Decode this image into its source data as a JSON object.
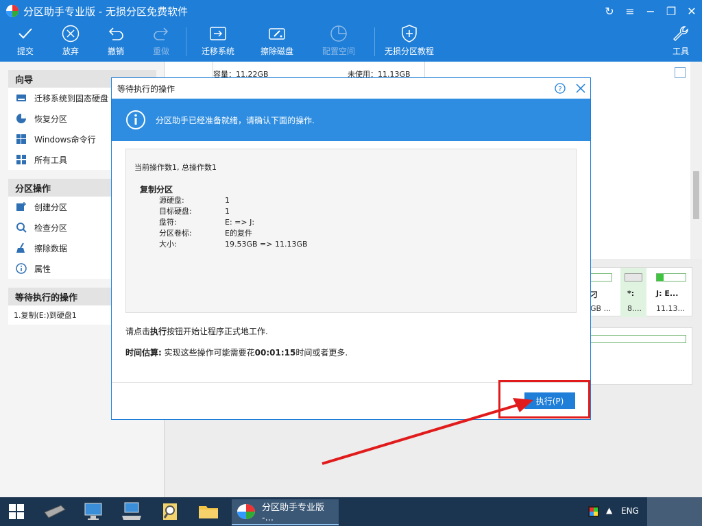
{
  "window": {
    "title": "分区助手专业版 - 无损分区免费软件"
  },
  "toolbar": {
    "items": [
      {
        "label": "提交",
        "icon": "check-icon",
        "enabled": true
      },
      {
        "label": "放弃",
        "icon": "cancel-circle-icon",
        "enabled": true
      },
      {
        "label": "撤销",
        "icon": "undo-icon",
        "enabled": true
      },
      {
        "label": "重做",
        "icon": "redo-icon",
        "enabled": false
      },
      {
        "label": "迁移系统",
        "icon": "migrate-disk-icon",
        "enabled": true
      },
      {
        "label": "擦除磁盘",
        "icon": "wipe-disk-icon",
        "enabled": true
      },
      {
        "label": "配置空间",
        "icon": "allocate-space-icon",
        "enabled": false
      },
      {
        "label": "无损分区教程",
        "icon": "shield-icon",
        "enabled": true
      },
      {
        "label": "工具",
        "icon": "wrench-icon",
        "enabled": true
      }
    ]
  },
  "sidebar": {
    "wizard": {
      "heading": "向导",
      "items": [
        {
          "label": "迁移系统到固态硬盘",
          "icon": "ssd-icon"
        },
        {
          "label": "恢复分区",
          "icon": "pie-icon"
        },
        {
          "label": "Windows命令行",
          "icon": "windows-icon"
        },
        {
          "label": "所有工具",
          "icon": "grid-icon"
        }
      ]
    },
    "partition_ops": {
      "heading": "分区操作",
      "items": [
        {
          "label": "创建分区",
          "icon": "create-partition-icon"
        },
        {
          "label": "检查分区",
          "icon": "check-partition-icon"
        },
        {
          "label": "擦除数据",
          "icon": "broom-icon"
        },
        {
          "label": "属性",
          "icon": "info-icon"
        }
      ]
    },
    "pending": {
      "heading": "等待执行的操作",
      "items": [
        "1.复制(E:)到硬盘1"
      ]
    }
  },
  "main": {
    "disk_capacity": "容量：11.22GB",
    "disk_unused": "未使用：11.13GB",
    "partitions": [
      {
        "label": "刁",
        "size": "GB ..."
      },
      {
        "label": "*:",
        "size": "8...."
      },
      {
        "label": "J: E...",
        "size": "11.13..."
      }
    ]
  },
  "dialog": {
    "title": "等待执行的操作",
    "banner": "分区助手已经准备就绪，请确认下面的操作.",
    "op_count": "当前操作数1, 总操作数1",
    "op_title": "复制分区",
    "op_details": [
      {
        "key": "源硬盘:",
        "value": "1"
      },
      {
        "key": "目标硬盘:",
        "value": "1"
      },
      {
        "key": "盘符:",
        "value": "E: => J:"
      },
      {
        "key": "分区卷标:",
        "value": "E的复件"
      },
      {
        "key": "大小:",
        "value": "19.53GB => 11.13GB"
      }
    ],
    "notice_prefix": "请点击",
    "notice_bold": "执行",
    "notice_suffix": "按钮开始让程序正式地工作.",
    "estimate_label": "时间估算:",
    "estimate_prefix": " 实现这些操作可能需要花",
    "estimate_time": "00:01:15",
    "estimate_suffix": "时间或者更多.",
    "execute_button": "执行(P)"
  },
  "taskbar": {
    "active_app": "分区助手专业版 -...",
    "language": "ENG"
  },
  "colors": {
    "accent": "#1e7ed8",
    "highlight": "#e11b1b",
    "taskbar": "#1b3550"
  }
}
